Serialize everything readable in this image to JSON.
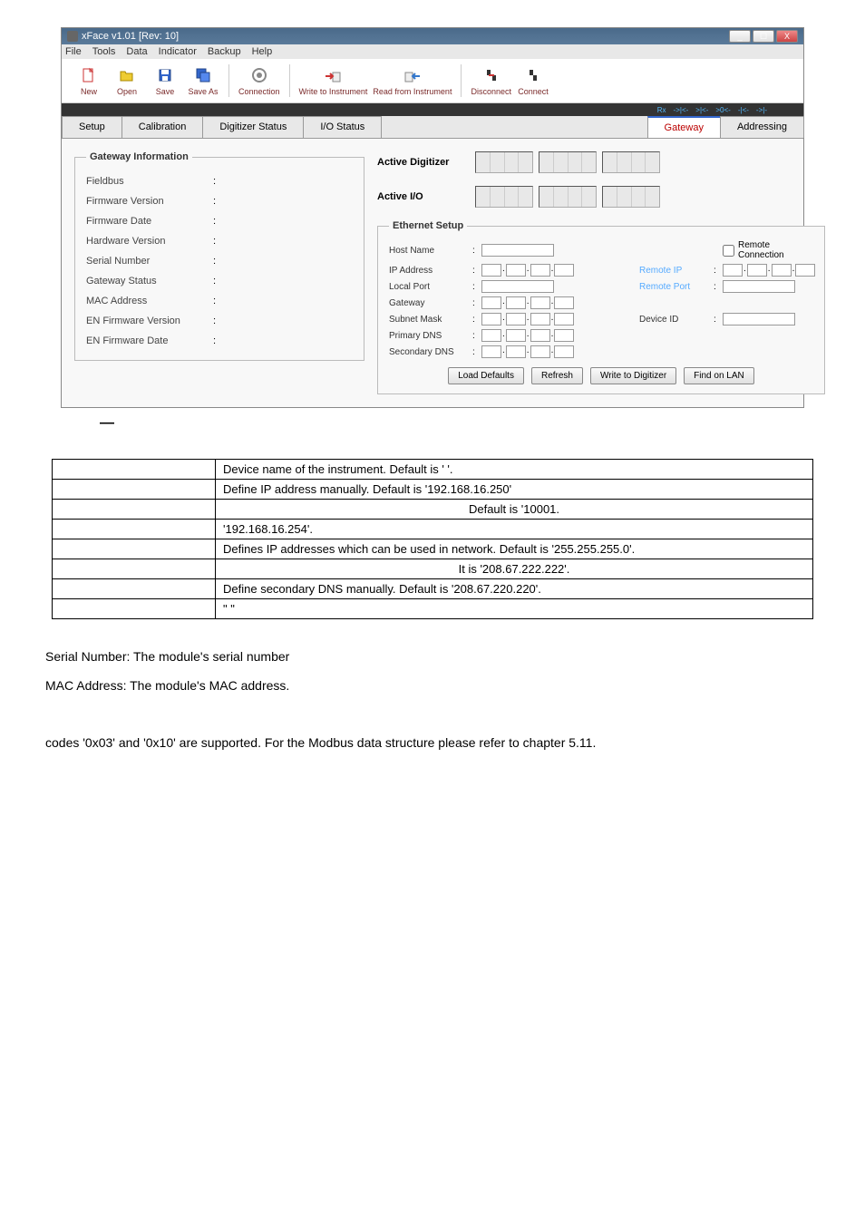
{
  "window": {
    "title": "xFace  v1.01        [Rev: 10]",
    "minimize": "_",
    "maximize": "☐",
    "close": "X"
  },
  "menubar": [
    "File",
    "Tools",
    "Data",
    "Indicator",
    "Backup",
    "Help"
  ],
  "toolbar": {
    "new": "New",
    "open": "Open",
    "save": "Save",
    "save_as": "Save\nAs",
    "connection": "Connection",
    "write_to": "Write to\nInstrument",
    "read_from": "Read from\nInstrument",
    "disconnect": "Disconnect",
    "connect": "Connect"
  },
  "led_labels": [
    "Rx",
    "->|<-",
    ">|<-",
    ">0<-",
    "-|<-",
    "->|-"
  ],
  "tabs": {
    "setup": "Setup",
    "calibration": "Calibration",
    "digitizer_status": "Digitizer Status",
    "io_status": "I/O Status",
    "gateway": "Gateway",
    "addressing": "Addressing"
  },
  "gateway_info": {
    "legend": "Gateway Information",
    "rows": [
      "Fieldbus",
      "Firmware Version",
      "Firmware Date",
      "Hardware Version",
      "Serial Number",
      "Gateway Status",
      "MAC Address",
      "EN Firmware Version",
      "EN Firmware Date"
    ]
  },
  "active_digitizer": "Active Digitizer",
  "active_io": "Active I/O",
  "ethernet": {
    "legend": "Ethernet Setup",
    "host_name": "Host Name",
    "ip_address": "IP Address",
    "local_port": "Local Port",
    "gateway": "Gateway",
    "subnet_mask": "Subnet Mask",
    "primary_dns": "Primary DNS",
    "secondary_dns": "Secondary DNS",
    "remote_connection": "Remote Connection",
    "remote_ip": "Remote IP",
    "remote_port": "Remote Port",
    "device_id": "Device ID"
  },
  "buttons": {
    "load_defaults": "Load Defaults",
    "refresh": "Refresh",
    "write_to_digitizer": "Write to Digitizer",
    "find_on_lan": "Find on LAN"
  },
  "dash": "—",
  "table": [
    [
      "",
      "Device name of the instrument. Default is ' '."
    ],
    [
      "",
      "Define IP address manually. Default is '192.168.16.250'"
    ],
    [
      "",
      "Default is '10001."
    ],
    [
      "",
      "'192.168.16.254'."
    ],
    [
      "",
      "Defines IP addresses which can be used in network. Default is '255.255.255.0'."
    ],
    [
      "",
      "It is '208.67.222.222'."
    ],
    [
      "",
      "Define secondary DNS manually. Default is '208.67.220.220'."
    ],
    [
      "",
      "\"          \""
    ]
  ],
  "body_text": [
    "Serial Number: The module's serial number",
    "MAC Address: The module's MAC address.",
    "codes '0x03' and '0x10' are supported. For the Modbus data structure please refer to chapter 5.11."
  ]
}
